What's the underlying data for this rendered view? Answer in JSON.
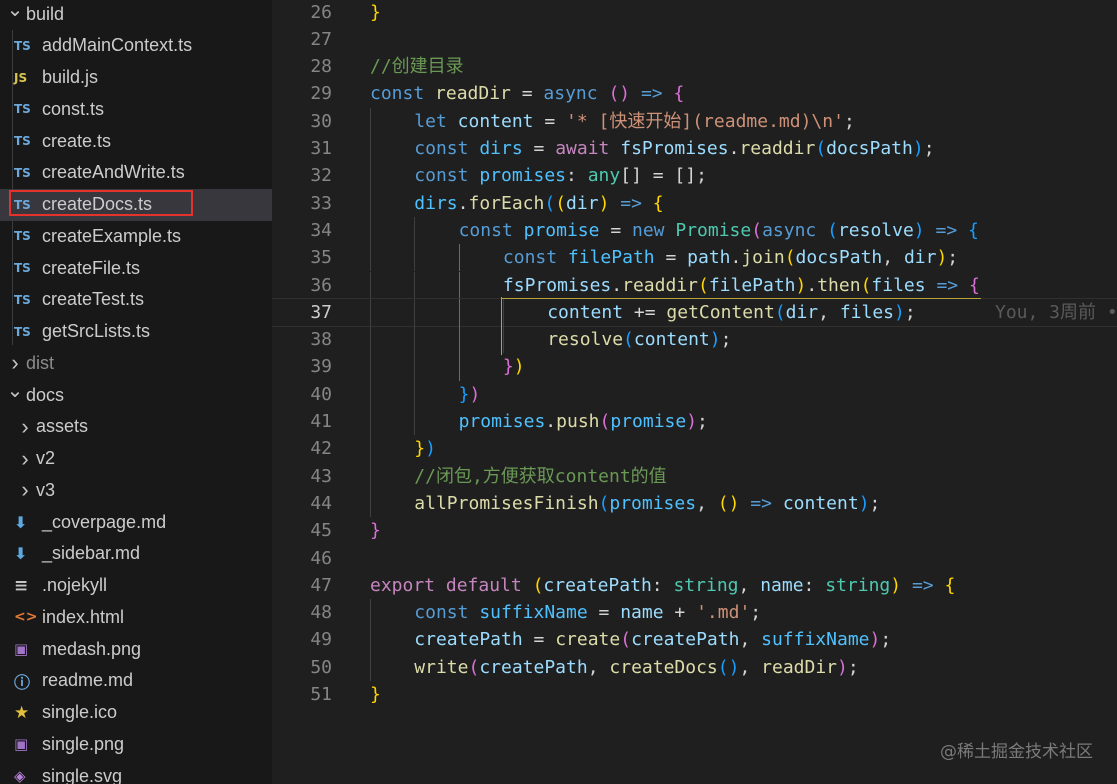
{
  "explorer": {
    "items": [
      {
        "type": "folder",
        "open": true,
        "name": "build",
        "indent": 0
      },
      {
        "type": "file",
        "icon": "ts",
        "name": "addMainContext.ts",
        "indent": 1
      },
      {
        "type": "file",
        "icon": "js",
        "name": "build.js",
        "indent": 1
      },
      {
        "type": "file",
        "icon": "ts",
        "name": "const.ts",
        "indent": 1
      },
      {
        "type": "file",
        "icon": "ts",
        "name": "create.ts",
        "indent": 1
      },
      {
        "type": "file",
        "icon": "ts",
        "name": "createAndWrite.ts",
        "indent": 1
      },
      {
        "type": "file",
        "icon": "ts",
        "name": "createDocs.ts",
        "indent": 1,
        "selected": true
      },
      {
        "type": "file",
        "icon": "ts",
        "name": "createExample.ts",
        "indent": 1
      },
      {
        "type": "file",
        "icon": "ts",
        "name": "createFile.ts",
        "indent": 1
      },
      {
        "type": "file",
        "icon": "ts",
        "name": "createTest.ts",
        "indent": 1
      },
      {
        "type": "file",
        "icon": "ts",
        "name": "getSrcLists.ts",
        "indent": 1
      },
      {
        "type": "folder",
        "open": false,
        "name": "dist",
        "indent": 0,
        "dim": true
      },
      {
        "type": "folder",
        "open": true,
        "name": "docs",
        "indent": 0
      },
      {
        "type": "folder",
        "open": false,
        "name": "assets",
        "indent": 1
      },
      {
        "type": "folder",
        "open": false,
        "name": "v2",
        "indent": 1
      },
      {
        "type": "folder",
        "open": false,
        "name": "v3",
        "indent": 1
      },
      {
        "type": "file",
        "icon": "md",
        "name": "_coverpage.md",
        "indent": 1
      },
      {
        "type": "file",
        "icon": "md",
        "name": "_sidebar.md",
        "indent": 1
      },
      {
        "type": "file",
        "icon": "lines",
        "name": ".nojekyll",
        "indent": 1
      },
      {
        "type": "file",
        "icon": "html",
        "name": "index.html",
        "indent": 1
      },
      {
        "type": "file",
        "icon": "img",
        "name": "medash.png",
        "indent": 1
      },
      {
        "type": "file",
        "icon": "info",
        "name": "readme.md",
        "indent": 1
      },
      {
        "type": "file",
        "icon": "star",
        "name": "single.ico",
        "indent": 1
      },
      {
        "type": "file",
        "icon": "img",
        "name": "single.png",
        "indent": 1
      },
      {
        "type": "file",
        "icon": "svg",
        "name": "single.svg",
        "indent": 1
      }
    ]
  },
  "icons": {
    "ts": "TS",
    "js": "JS",
    "md": "⬇",
    "lines": "≡",
    "html": "<>",
    "img": "▣",
    "info": "ⓘ",
    "star": "★",
    "svg": "◈",
    "chevron_open": "⌄",
    "chevron_closed": "›"
  },
  "editor": {
    "current_line": 37,
    "blame": "You, 3周前 •",
    "lines": [
      {
        "n": 26,
        "indent": 0,
        "t": [
          [
            "b1",
            "}"
          ]
        ]
      },
      {
        "n": 27,
        "indent": 0,
        "t": []
      },
      {
        "n": 28,
        "indent": 0,
        "t": [
          [
            "t-cmt",
            "//创建目录"
          ]
        ]
      },
      {
        "n": 29,
        "indent": 0,
        "t": [
          [
            "t-kw",
            "const "
          ],
          [
            "t-fn",
            "readDir"
          ],
          [
            "t-p",
            " = "
          ],
          [
            "t-kw",
            "async "
          ],
          [
            "b2",
            "()"
          ],
          [
            "t-p",
            " "
          ],
          [
            "t-kw",
            "=>"
          ],
          [
            "t-p",
            " "
          ],
          [
            "b2",
            "{"
          ]
        ]
      },
      {
        "n": 30,
        "indent": 1,
        "t": [
          [
            "t-kw",
            "let "
          ],
          [
            "t-var",
            "content"
          ],
          [
            "t-p",
            " = "
          ],
          [
            "t-str",
            "'* [快速开始](readme.md)\\n'"
          ],
          [
            "t-p",
            ";"
          ]
        ]
      },
      {
        "n": 31,
        "indent": 1,
        "t": [
          [
            "t-kw",
            "const "
          ],
          [
            "t-const",
            "dirs"
          ],
          [
            "t-p",
            " = "
          ],
          [
            "t-ctl",
            "await "
          ],
          [
            "t-var",
            "fsPromises"
          ],
          [
            "t-p",
            "."
          ],
          [
            "t-fn",
            "readdir"
          ],
          [
            "b3",
            "("
          ],
          [
            "t-var",
            "docsPath"
          ],
          [
            "b3",
            ")"
          ],
          [
            "t-p",
            ";"
          ]
        ]
      },
      {
        "n": 32,
        "indent": 1,
        "t": [
          [
            "t-kw",
            "const "
          ],
          [
            "t-const",
            "promises"
          ],
          [
            "t-p",
            ": "
          ],
          [
            "t-type",
            "any"
          ],
          [
            "t-p",
            "[] = [];"
          ]
        ]
      },
      {
        "n": 33,
        "indent": 1,
        "t": [
          [
            "t-const",
            "dirs"
          ],
          [
            "t-p",
            "."
          ],
          [
            "t-fn",
            "forEach"
          ],
          [
            "b3",
            "("
          ],
          [
            "b1",
            "("
          ],
          [
            "t-var",
            "dir"
          ],
          [
            "b1",
            ")"
          ],
          [
            "t-p",
            " "
          ],
          [
            "t-kw",
            "=>"
          ],
          [
            "t-p",
            " "
          ],
          [
            "b1",
            "{"
          ]
        ]
      },
      {
        "n": 34,
        "indent": 2,
        "t": [
          [
            "t-kw",
            "const "
          ],
          [
            "t-const",
            "promise"
          ],
          [
            "t-p",
            " = "
          ],
          [
            "t-kw",
            "new "
          ],
          [
            "t-type",
            "Promise"
          ],
          [
            "b2",
            "("
          ],
          [
            "t-kw",
            "async "
          ],
          [
            "b3",
            "("
          ],
          [
            "t-var",
            "resolve"
          ],
          [
            "b3",
            ")"
          ],
          [
            "t-p",
            " "
          ],
          [
            "t-kw",
            "=>"
          ],
          [
            "t-p",
            " "
          ],
          [
            "b3",
            "{"
          ]
        ]
      },
      {
        "n": 35,
        "indent": 3,
        "t": [
          [
            "t-kw",
            "const "
          ],
          [
            "t-const",
            "filePath"
          ],
          [
            "t-p",
            " = "
          ],
          [
            "t-var",
            "path"
          ],
          [
            "t-p",
            "."
          ],
          [
            "t-fn",
            "join"
          ],
          [
            "b1",
            "("
          ],
          [
            "t-var",
            "docsPath"
          ],
          [
            "t-p",
            ", "
          ],
          [
            "t-var",
            "dir"
          ],
          [
            "b1",
            ")"
          ],
          [
            "t-p",
            ";"
          ]
        ]
      },
      {
        "n": 36,
        "indent": 3,
        "t": [
          [
            "t-var",
            "fsPromises"
          ],
          [
            "t-p",
            "."
          ],
          [
            "t-fn",
            "readdir"
          ],
          [
            "b1",
            "("
          ],
          [
            "t-var",
            "filePath"
          ],
          [
            "b1",
            ")"
          ],
          [
            "t-p",
            "."
          ],
          [
            "t-fn",
            "then"
          ],
          [
            "b1",
            "("
          ],
          [
            "t-var",
            "files"
          ],
          [
            "t-p",
            " "
          ],
          [
            "t-kw",
            "=>"
          ],
          [
            "t-p",
            " "
          ],
          [
            "b2",
            "{"
          ]
        ]
      },
      {
        "n": 37,
        "indent": 4,
        "t": [
          [
            "t-var",
            "content"
          ],
          [
            "t-p",
            " += "
          ],
          [
            "t-fn",
            "getContent"
          ],
          [
            "b3",
            "("
          ],
          [
            "t-var",
            "dir"
          ],
          [
            "t-p",
            ", "
          ],
          [
            "t-var",
            "files"
          ],
          [
            "b3",
            ")"
          ],
          [
            "t-p",
            ";"
          ]
        ]
      },
      {
        "n": 38,
        "indent": 4,
        "t": [
          [
            "t-fn",
            "resolve"
          ],
          [
            "b3",
            "("
          ],
          [
            "t-var",
            "content"
          ],
          [
            "b3",
            ")"
          ],
          [
            "t-p",
            ";"
          ]
        ]
      },
      {
        "n": 39,
        "indent": 3,
        "t": [
          [
            "b2",
            "}"
          ],
          [
            "b1",
            ")"
          ]
        ]
      },
      {
        "n": 40,
        "indent": 2,
        "t": [
          [
            "b3",
            "}"
          ],
          [
            "b2",
            ")"
          ]
        ]
      },
      {
        "n": 41,
        "indent": 2,
        "t": [
          [
            "t-const",
            "promises"
          ],
          [
            "t-p",
            "."
          ],
          [
            "t-fn",
            "push"
          ],
          [
            "b2",
            "("
          ],
          [
            "t-const",
            "promise"
          ],
          [
            "b2",
            ")"
          ],
          [
            "t-p",
            ";"
          ]
        ]
      },
      {
        "n": 42,
        "indent": 1,
        "t": [
          [
            "b1",
            "}"
          ],
          [
            "b3",
            ")"
          ]
        ]
      },
      {
        "n": 43,
        "indent": 1,
        "t": [
          [
            "t-cmt",
            "//闭包,方便获取content的值"
          ]
        ]
      },
      {
        "n": 44,
        "indent": 1,
        "t": [
          [
            "t-fn",
            "allPromisesFinish"
          ],
          [
            "b3",
            "("
          ],
          [
            "t-const",
            "promises"
          ],
          [
            "t-p",
            ", "
          ],
          [
            "b1",
            "()"
          ],
          [
            "t-p",
            " "
          ],
          [
            "t-kw",
            "=>"
          ],
          [
            "t-p",
            " "
          ],
          [
            "t-var",
            "content"
          ],
          [
            "b3",
            ")"
          ],
          [
            "t-p",
            ";"
          ]
        ]
      },
      {
        "n": 45,
        "indent": 0,
        "t": [
          [
            "b2",
            "}"
          ]
        ]
      },
      {
        "n": 46,
        "indent": 0,
        "t": []
      },
      {
        "n": 47,
        "indent": 0,
        "t": [
          [
            "t-ctl",
            "export "
          ],
          [
            "t-ctl",
            "default "
          ],
          [
            "b1",
            "("
          ],
          [
            "t-var",
            "createPath"
          ],
          [
            "t-p",
            ": "
          ],
          [
            "t-type",
            "string"
          ],
          [
            "t-p",
            ", "
          ],
          [
            "t-var",
            "name"
          ],
          [
            "t-p",
            ": "
          ],
          [
            "t-type",
            "string"
          ],
          [
            "b1",
            ")"
          ],
          [
            "t-p",
            " "
          ],
          [
            "t-kw",
            "=>"
          ],
          [
            "t-p",
            " "
          ],
          [
            "b1",
            "{"
          ]
        ]
      },
      {
        "n": 48,
        "indent": 1,
        "t": [
          [
            "t-kw",
            "const "
          ],
          [
            "t-const",
            "suffixName"
          ],
          [
            "t-p",
            " = "
          ],
          [
            "t-var",
            "name"
          ],
          [
            "t-p",
            " + "
          ],
          [
            "t-str",
            "'.md'"
          ],
          [
            "t-p",
            ";"
          ]
        ]
      },
      {
        "n": 49,
        "indent": 1,
        "t": [
          [
            "t-var",
            "createPath"
          ],
          [
            "t-p",
            " = "
          ],
          [
            "t-fn",
            "create"
          ],
          [
            "b2",
            "("
          ],
          [
            "t-var",
            "createPath"
          ],
          [
            "t-p",
            ", "
          ],
          [
            "t-const",
            "suffixName"
          ],
          [
            "b2",
            ")"
          ],
          [
            "t-p",
            ";"
          ]
        ]
      },
      {
        "n": 50,
        "indent": 1,
        "t": [
          [
            "t-fn",
            "write"
          ],
          [
            "b2",
            "("
          ],
          [
            "t-var",
            "createPath"
          ],
          [
            "t-p",
            ", "
          ],
          [
            "t-fn",
            "createDocs"
          ],
          [
            "b3",
            "()"
          ],
          [
            "t-p",
            ", "
          ],
          [
            "t-fn",
            "readDir"
          ],
          [
            "b2",
            ")"
          ],
          [
            "t-p",
            ";"
          ]
        ]
      },
      {
        "n": 51,
        "indent": 0,
        "t": [
          [
            "b1",
            "}"
          ]
        ]
      }
    ]
  },
  "watermark": "@稀土掘金技术社区"
}
